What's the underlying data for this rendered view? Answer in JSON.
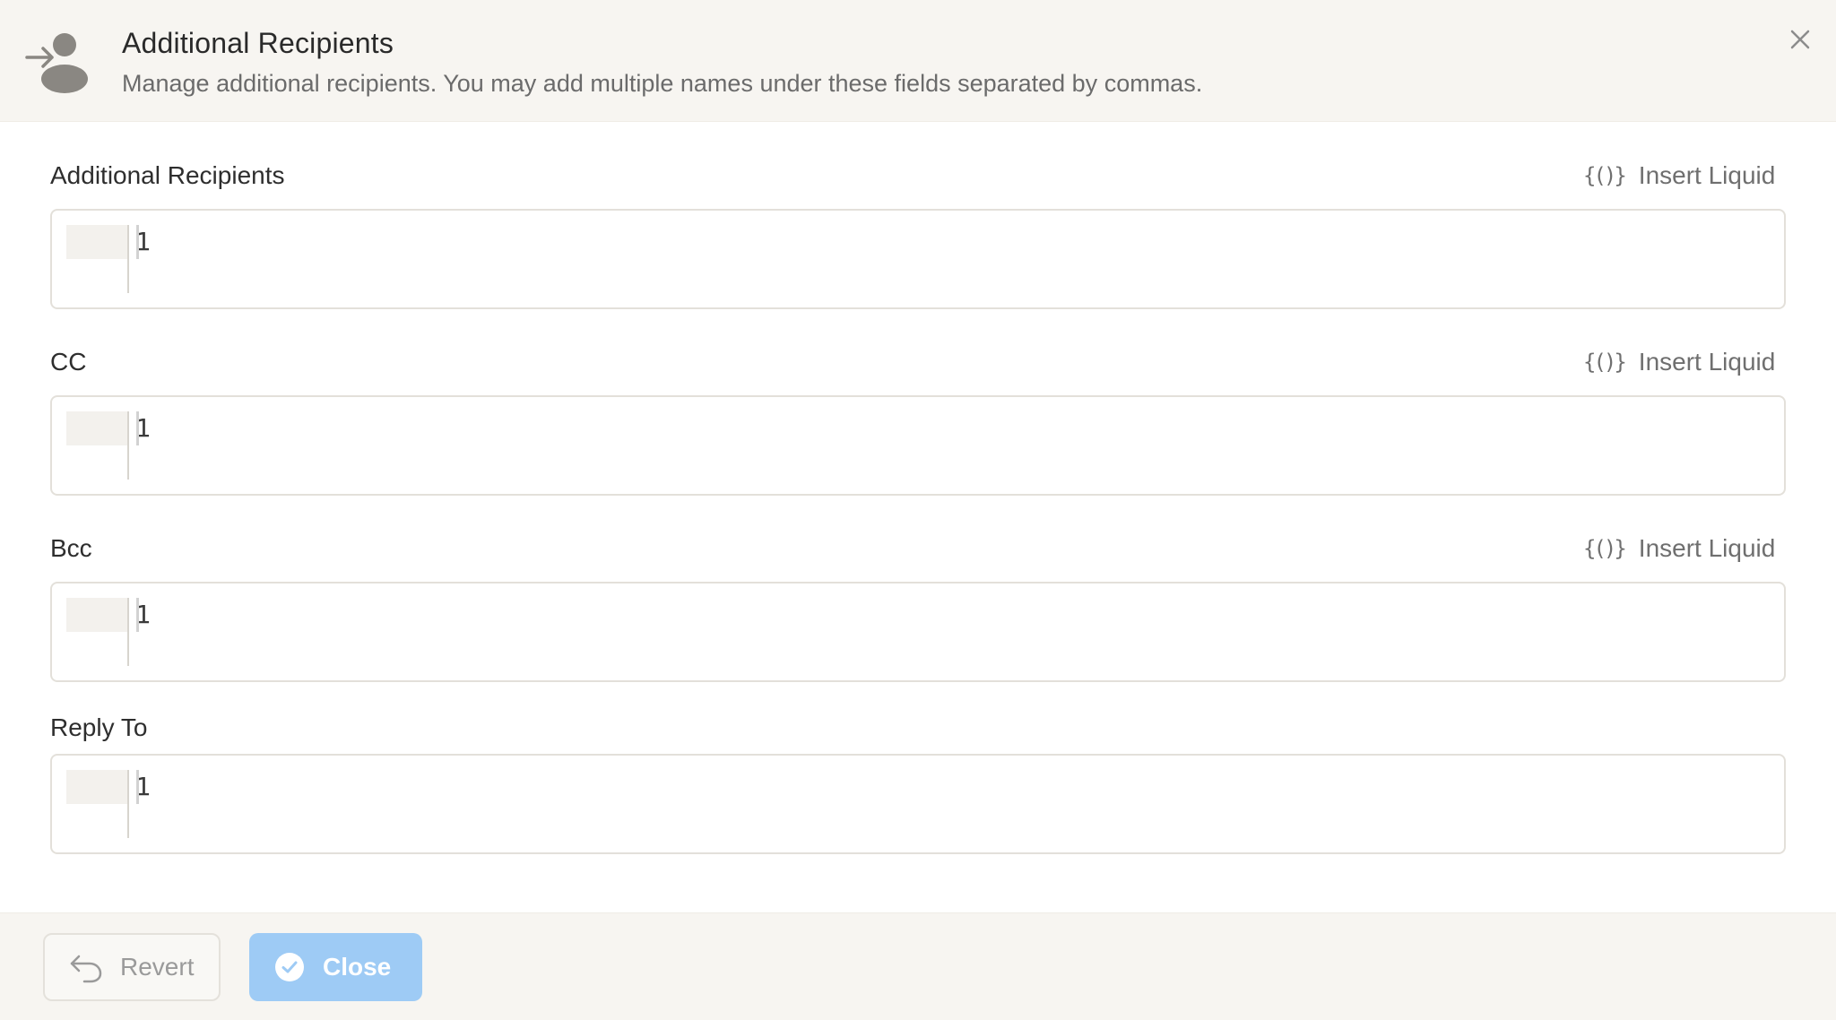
{
  "header": {
    "title": "Additional Recipients",
    "subtitle": "Manage additional recipients. You may add multiple names under these fields separated by commas.",
    "icon": "user-arrow-icon",
    "close_icon": "close-icon"
  },
  "fields": [
    {
      "label": "Additional Recipients",
      "insert_label": "Insert Liquid",
      "insert_icon": "{()}",
      "line_number": "1",
      "value": ""
    },
    {
      "label": "CC",
      "insert_label": "Insert Liquid",
      "insert_icon": "{()}",
      "line_number": "1",
      "value": ""
    },
    {
      "label": "Bcc",
      "insert_label": "Insert Liquid",
      "insert_icon": "{()}",
      "line_number": "1",
      "value": ""
    },
    {
      "label": "Reply To",
      "line_number": "1",
      "value": ""
    }
  ],
  "footer": {
    "revert_label": "Revert",
    "close_label": "Close"
  },
  "colors": {
    "header_bg": "#f7f5f1",
    "close_button_bg": "#9ecbf5",
    "border": "#e3e0da"
  }
}
